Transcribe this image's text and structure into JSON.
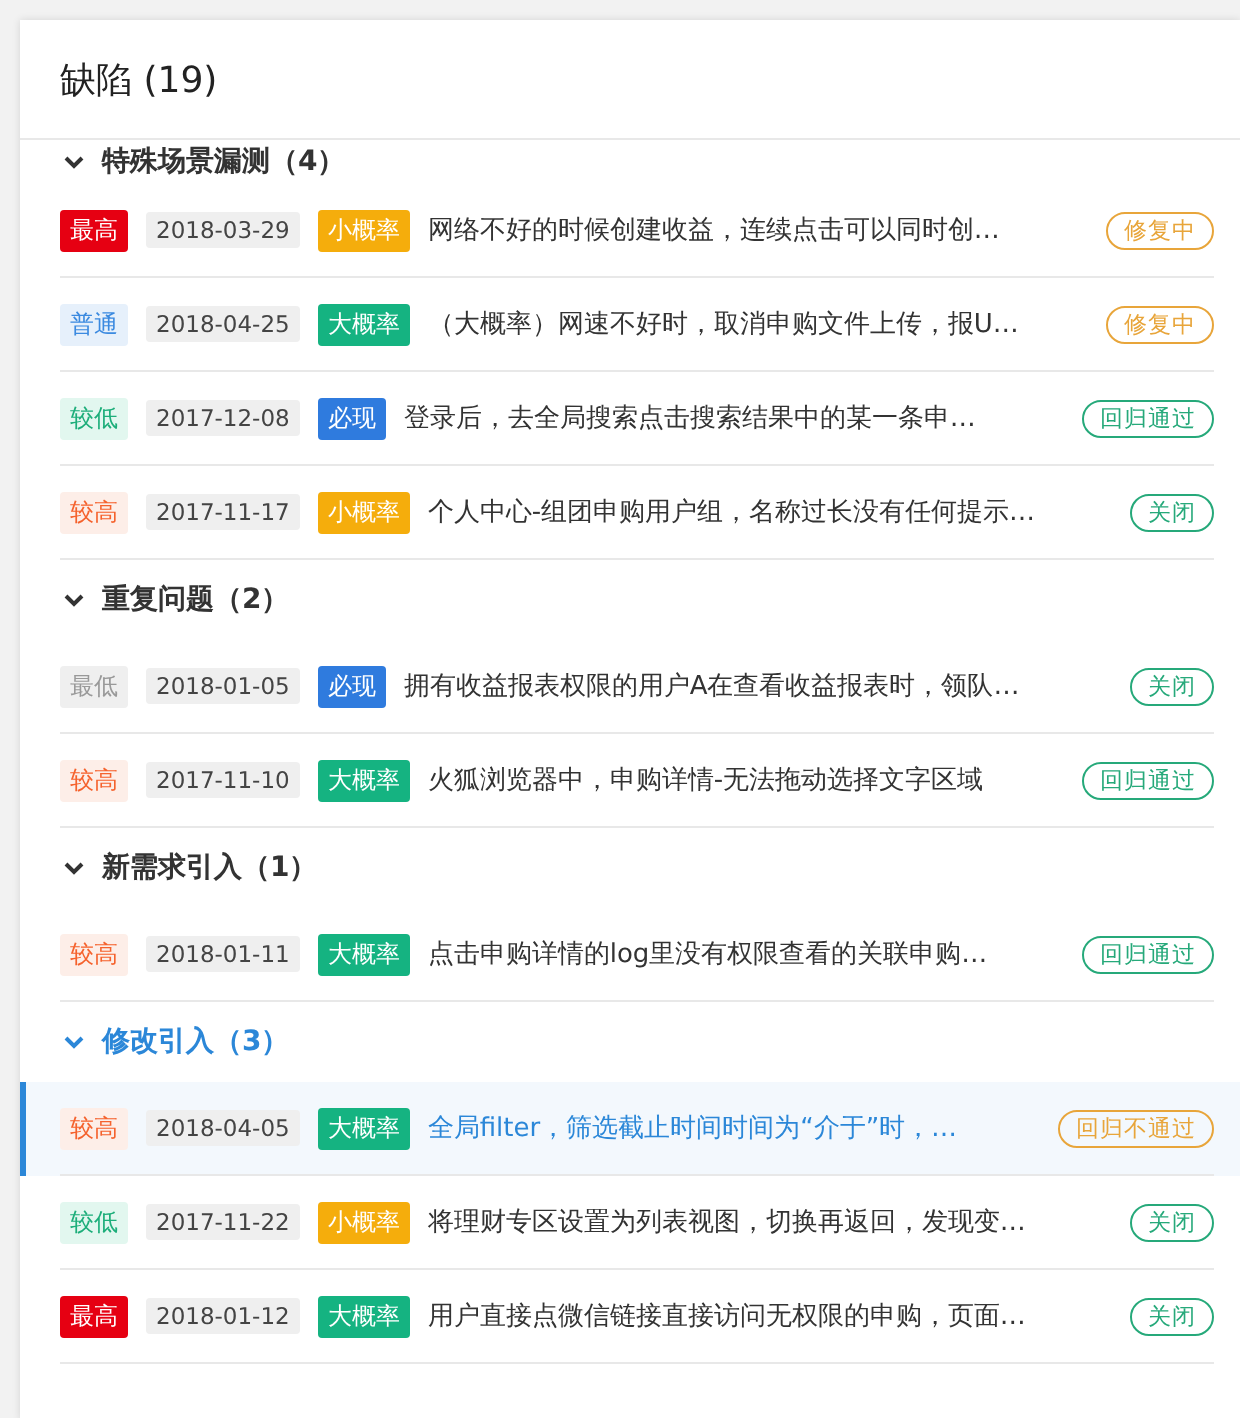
{
  "panel": {
    "title": "缺陷 (19)"
  },
  "groups": [
    {
      "name": "特殊场景漏测（4）",
      "expanded": true,
      "selected": false,
      "rows": [
        {
          "priority": {
            "label": "最高",
            "kind": "highest"
          },
          "date": "2018-03-29",
          "probability": {
            "label": "小概率",
            "kind": "low"
          },
          "title": "网络不好的时候创建收益，连续点击可以同时创…",
          "status": {
            "label": "修复中",
            "kind": "fixing"
          },
          "selected": false
        },
        {
          "priority": {
            "label": "普通",
            "kind": "normal"
          },
          "date": "2018-04-25",
          "probability": {
            "label": "大概率",
            "kind": "high"
          },
          "title": "（大概率）网速不好时，取消申购文件上传，报U…",
          "status": {
            "label": "修复中",
            "kind": "fixing"
          },
          "selected": false
        },
        {
          "priority": {
            "label": "较低",
            "kind": "low"
          },
          "date": "2017-12-08",
          "probability": {
            "label": "必现",
            "kind": "always"
          },
          "title": "登录后，去全局搜索点击搜索结果中的某一条申…",
          "status": {
            "label": "回归通过",
            "kind": "passed"
          },
          "selected": false
        },
        {
          "priority": {
            "label": "较高",
            "kind": "high"
          },
          "date": "2017-11-17",
          "probability": {
            "label": "小概率",
            "kind": "low"
          },
          "title": "个人中心-组团申购用户组，名称过长没有任何提示…",
          "status": {
            "label": "关闭",
            "kind": "closed"
          },
          "selected": false
        }
      ]
    },
    {
      "name": "重复问题（2）",
      "expanded": true,
      "selected": false,
      "rows": [
        {
          "priority": {
            "label": "最低",
            "kind": "lowest"
          },
          "date": "2018-01-05",
          "probability": {
            "label": "必现",
            "kind": "always"
          },
          "title": "拥有收益报表权限的用户A在查看收益报表时，领队…",
          "status": {
            "label": "关闭",
            "kind": "closed"
          },
          "selected": false
        },
        {
          "priority": {
            "label": "较高",
            "kind": "high"
          },
          "date": "2017-11-10",
          "probability": {
            "label": "大概率",
            "kind": "high"
          },
          "title": "火狐浏览器中，申购详情-无法拖动选择文字区域",
          "status": {
            "label": "回归通过",
            "kind": "passed"
          },
          "selected": false
        }
      ]
    },
    {
      "name": "新需求引入（1）",
      "expanded": true,
      "selected": false,
      "rows": [
        {
          "priority": {
            "label": "较高",
            "kind": "high"
          },
          "date": "2018-01-11",
          "probability": {
            "label": "大概率",
            "kind": "high"
          },
          "title": "点击申购详情的log里没有权限查看的关联申购…",
          "status": {
            "label": "回归通过",
            "kind": "passed"
          },
          "selected": false
        }
      ]
    },
    {
      "name": "修改引入（3）",
      "expanded": true,
      "selected": true,
      "rows": [
        {
          "priority": {
            "label": "较高",
            "kind": "high"
          },
          "date": "2018-04-05",
          "probability": {
            "label": "大概率",
            "kind": "high"
          },
          "title": "全局filter，筛选截止时间时间为“介于”时，…",
          "status": {
            "label": "回归不通过",
            "kind": "failed"
          },
          "selected": true
        },
        {
          "priority": {
            "label": "较低",
            "kind": "low"
          },
          "date": "2017-11-22",
          "probability": {
            "label": "小概率",
            "kind": "low"
          },
          "title": "将理财专区设置为列表视图，切换再返回，发现变…",
          "status": {
            "label": "关闭",
            "kind": "closed"
          },
          "selected": false
        },
        {
          "priority": {
            "label": "最高",
            "kind": "highest"
          },
          "date": "2018-01-12",
          "probability": {
            "label": "大概率",
            "kind": "high"
          },
          "title": "用户直接点微信链接直接访问无权限的申购，页面…",
          "status": {
            "label": "关闭",
            "kind": "closed"
          },
          "selected": false
        }
      ]
    }
  ]
}
